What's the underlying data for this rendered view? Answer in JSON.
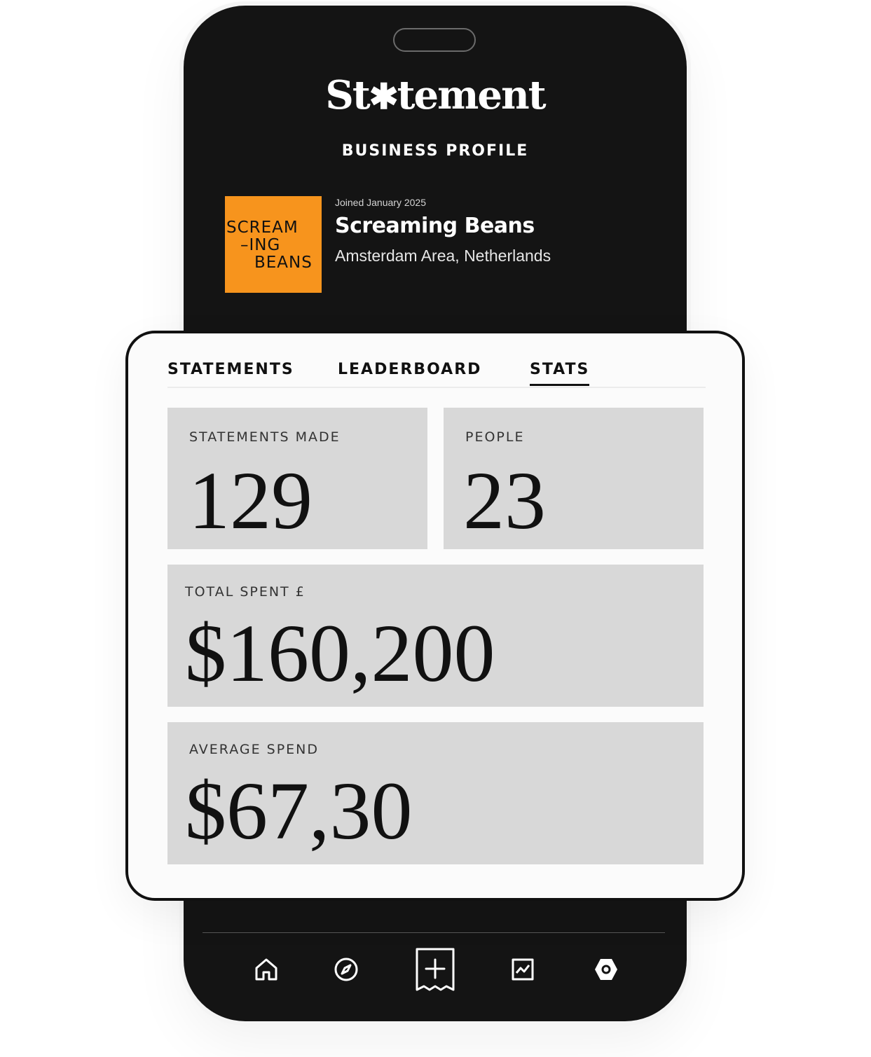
{
  "header": {
    "logo_prefix": "St",
    "logo_star": "✱",
    "logo_suffix": "tement",
    "section_title": "BUSINESS PROFILE"
  },
  "business": {
    "logo_lines": [
      "SCREAM",
      "–ING",
      "BEANS"
    ],
    "logo_color": "#f7941d",
    "joined": "Joined January 2025",
    "name": "Screaming Beans",
    "location": "Amsterdam Area, Netherlands"
  },
  "tabs": [
    {
      "label": "STATEMENTS",
      "active": false
    },
    {
      "label": "LEADERBOARD",
      "active": false
    },
    {
      "label": "STATS",
      "active": true
    }
  ],
  "stats": {
    "statements_made": {
      "label": "STATEMENTS MADE",
      "value": "129"
    },
    "people": {
      "label": "PEOPLE",
      "value": "23"
    },
    "total_spent": {
      "label": "TOTAL SPENT £",
      "value": "$160,200"
    },
    "average_spend": {
      "label": "AVERAGE SPEND",
      "value": "$67,30"
    }
  },
  "bottom_nav": [
    {
      "icon": "home-icon"
    },
    {
      "icon": "compass-icon"
    },
    {
      "icon": "add-statement-icon"
    },
    {
      "icon": "chart-icon"
    },
    {
      "icon": "settings-icon"
    }
  ],
  "colors": {
    "phone_bg": "#141414",
    "tile_bg": "#d8d8d8",
    "card_bg": "#fbfbfb"
  }
}
